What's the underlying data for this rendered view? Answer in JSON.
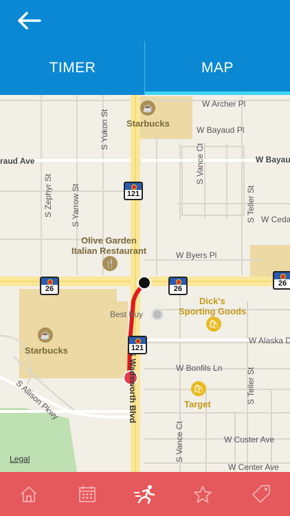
{
  "header": {
    "back_icon": "arrow-left-icon"
  },
  "tabs": [
    {
      "label": "TIMER",
      "active": false
    },
    {
      "label": "MAP",
      "active": true
    }
  ],
  "map": {
    "streets": {
      "archer": "W Archer Pl",
      "bayaud": "W Bayaud Pl",
      "bayaud_ave_left": "raud Ave",
      "bayaud_ave_right": "W Bayau",
      "ceda": "W Ceda",
      "byers": "W Byers Pl",
      "alaska": "W Alaska D",
      "bonfils": "W Bonfils Ln",
      "custer": "W Custer Ave",
      "center": "W Center Ave",
      "yukon": "S Yukon St",
      "zephyr": "S Zephyr St",
      "yarrow": "S Yarrow St",
      "vance_top": "S Vance Ct",
      "teller_top": "S Teller St",
      "teller_bottom": "S Teller St",
      "vance_bottom": "S Vance Ct",
      "allison": "S Allison Pkwy",
      "wadsworth": "S Wadsworth Blvd"
    },
    "pois": {
      "starbucks_top": "Starbucks",
      "starbucks_left": "Starbucks",
      "olive_garden_line1": "Olive Garden",
      "olive_garden_line2": "Italian Restaurant",
      "best_buy": "Best Buy",
      "dicks_line1": "Dick's",
      "dicks_line2": "Sporting Goods",
      "target": "Target"
    },
    "shields": {
      "s121_top": "121",
      "s121_bottom": "121",
      "s26_left": "26",
      "s26_mid": "26",
      "s26_right": "26"
    },
    "legal": "Legal",
    "route_color": "#e0191c",
    "start_marker_color": "#000000",
    "current_marker_color": "#e5404a"
  },
  "nav": [
    {
      "icon": "home-icon",
      "active": false
    },
    {
      "icon": "calendar-icon",
      "active": false
    },
    {
      "icon": "runner-icon",
      "active": true
    },
    {
      "icon": "star-icon",
      "active": false
    },
    {
      "icon": "tag-icon",
      "active": false
    }
  ]
}
